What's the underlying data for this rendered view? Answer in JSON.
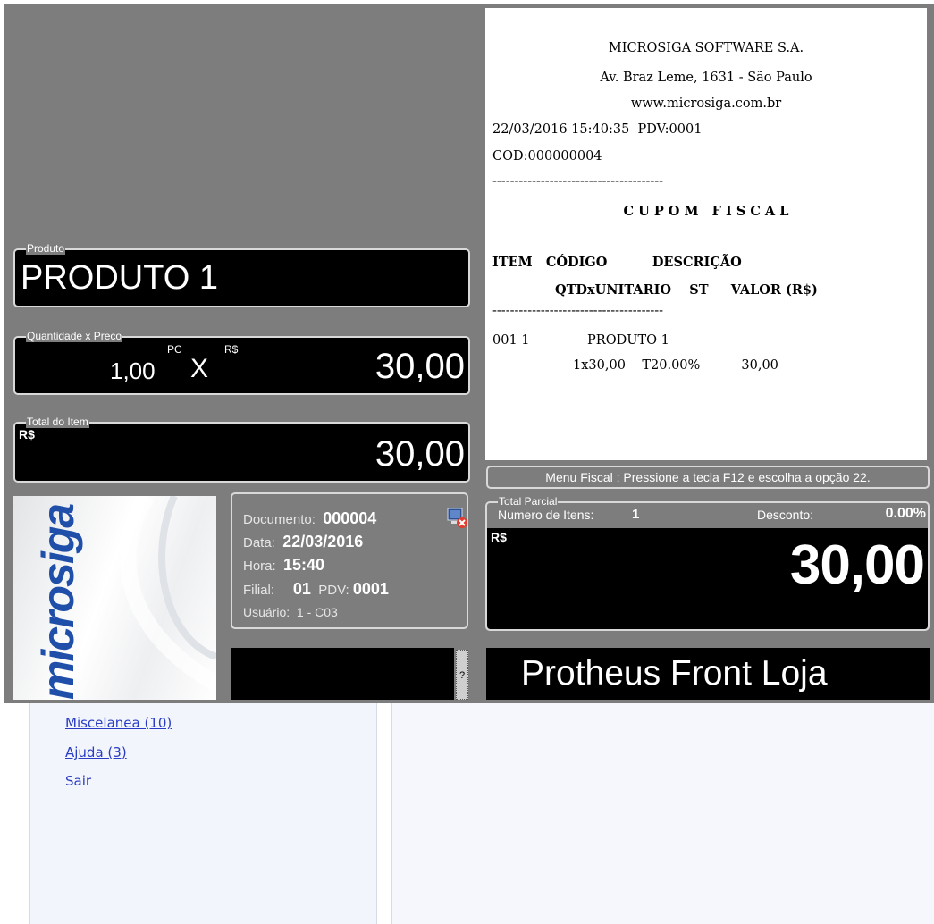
{
  "receipt": {
    "company": "MICROSIGA SOFTWARE S.A.",
    "address": "Av. Braz Leme, 1631 - São Paulo",
    "website": "www.microsiga.com.br",
    "datetime_pdv": "22/03/2016 15:40:35  PDV:0001",
    "cod": "COD:000000004",
    "separator": "---------------------------------------",
    "title": "C U P O M   F I S C A L",
    "header_line1": "ITEM   CÓDIGO          DESCRIÇÃO",
    "header_line2": "QTDxUNITARIO    ST     VALOR (R$)",
    "item_line1": "001 1              PRODUTO 1",
    "item_line2": "1x30,00    T20.00%          30,00"
  },
  "hint": "Menu Fiscal : Pressione a tecla F12 e escolha a opção 22.",
  "produto": {
    "legend": "Produto",
    "value": "PRODUTO 1"
  },
  "quantidade": {
    "legend": "Quantidade x Preco",
    "qty": "1,00",
    "unit": "PC",
    "times": "X",
    "currency": "R$",
    "price": "30,00"
  },
  "total_item": {
    "legend": "Total do Item",
    "currency": "R$",
    "value": "30,00"
  },
  "documento": {
    "doc_label": "Documento:",
    "doc_value": "000004",
    "data_label": "Data:",
    "data_value": "22/03/2016",
    "hora_label": "Hora:",
    "hora_value": "15:40",
    "filial_label": "Filial:",
    "filial_value": "01",
    "pdv_label": "PDV:",
    "pdv_value": "0001",
    "usuario_label": "Usuário:",
    "usuario_value": "1 - C03"
  },
  "total_parcial": {
    "legend": "Total Parcial",
    "itens_label": "Numero de Itens:",
    "itens_value": "1",
    "desconto_label": "Desconto:",
    "desconto_value": "0.00%",
    "currency": "R$",
    "value": "30,00"
  },
  "logo_text": "microsiga",
  "help_button": "?",
  "app_title": "Protheus Front Loja",
  "menu": [
    {
      "label": "Miscelanea (10)"
    },
    {
      "label": "Ajuda (3)"
    },
    {
      "label": "Sair"
    }
  ],
  "colors": {
    "background_gray": "#7d7d7d",
    "panel_black": "#000000",
    "logo_blue": "#1f4fa8",
    "menu_link": "#2a3cc4"
  }
}
